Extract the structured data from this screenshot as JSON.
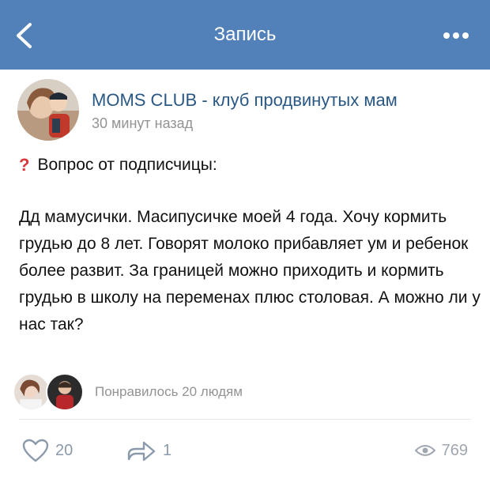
{
  "navbar": {
    "title": "Запись",
    "back_icon": "chevron-left-icon",
    "more_icon": "ellipsis-icon"
  },
  "post": {
    "group_name": "MOMS CLUB - клуб продвинутых мам",
    "time": "30 минут назад",
    "question_prefix_icon": "question-mark-icon",
    "question_heading": "Вопрос от подписчицы:",
    "body": "Дд мамусички. Масипусичке моей 4 года. Хочу кормить грудью до 8 лет. Говорят молоко прибавляет ум и ребенок более развит. За границей можно приходить и кормить грудью в школу на переменах плюс столовая. А можно ли у нас так?"
  },
  "likes": {
    "liked_text": "Понравилось 20 людям"
  },
  "actions": {
    "like_count": "20",
    "share_count": "1",
    "views_count": "769"
  },
  "colors": {
    "header_bg": "#5181b8",
    "link": "#2a5885",
    "muted": "#939393",
    "question_mark": "#d9363e"
  }
}
